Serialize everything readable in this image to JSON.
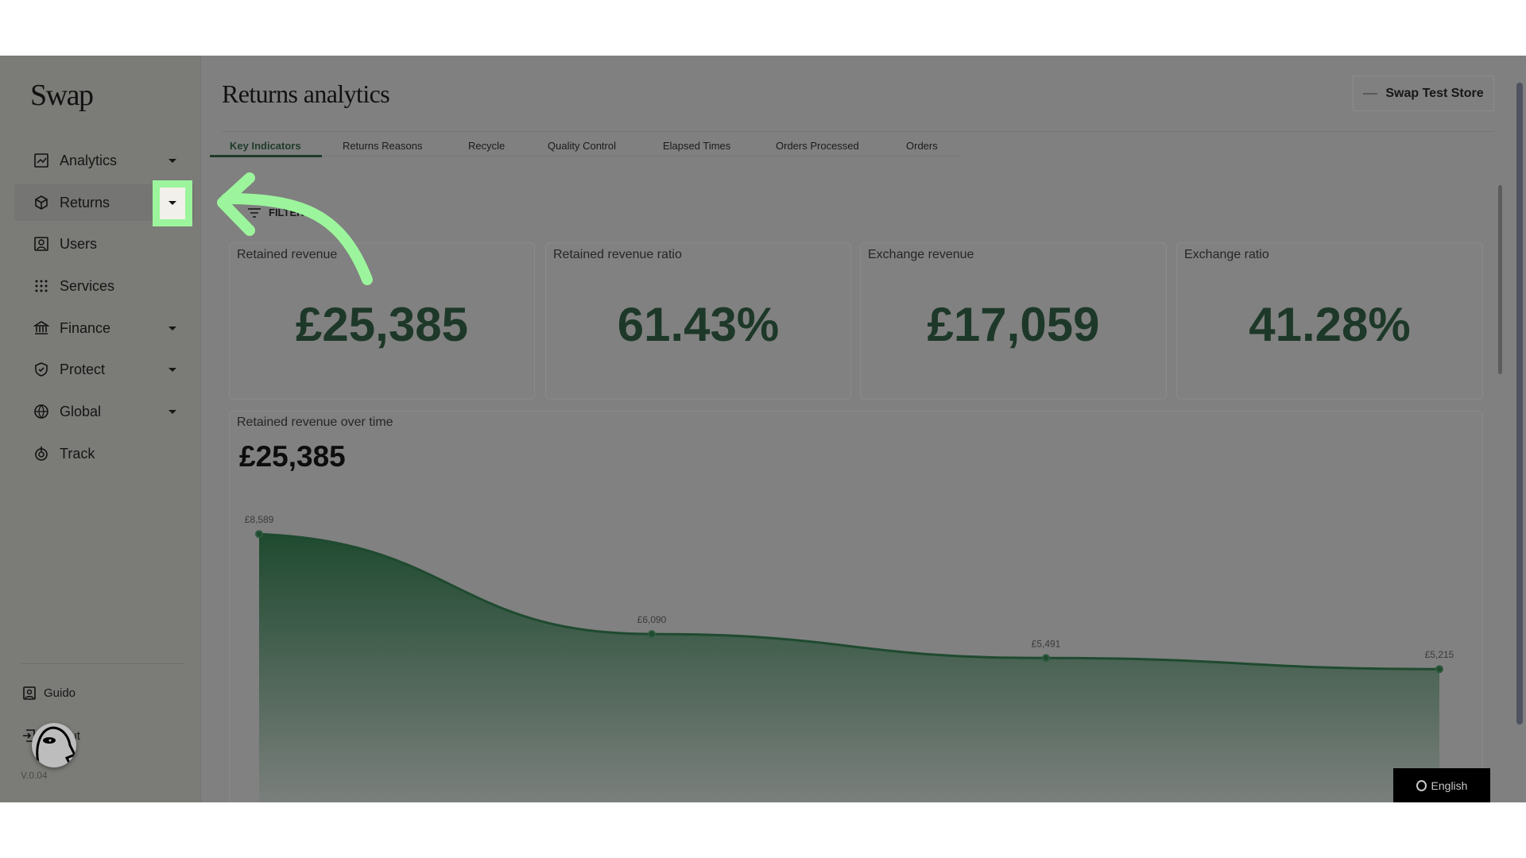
{
  "sidebar": {
    "logo": "Swap",
    "items": [
      {
        "label": "Analytics",
        "icon": "chart-icon",
        "has_dropdown": true
      },
      {
        "label": "Returns",
        "icon": "box-icon",
        "has_dropdown": true,
        "active": true
      },
      {
        "label": "Users",
        "icon": "user-icon",
        "has_dropdown": false
      },
      {
        "label": "Services",
        "icon": "grid-icon",
        "has_dropdown": false
      },
      {
        "label": "Finance",
        "icon": "bank-icon",
        "has_dropdown": true
      },
      {
        "label": "Protect",
        "icon": "shield-icon",
        "has_dropdown": true
      },
      {
        "label": "Global",
        "icon": "globe-icon",
        "has_dropdown": true
      },
      {
        "label": "Track",
        "icon": "track-icon",
        "has_dropdown": false
      }
    ],
    "user": "Guido",
    "logout": "Logout",
    "version": "V.0.04"
  },
  "header": {
    "title": "Returns analytics",
    "store": "Swap Test Store"
  },
  "tabs": [
    "Key Indicators",
    "Returns Reasons",
    "Recycle",
    "Quality Control",
    "Elapsed Times",
    "Orders Processed",
    "Orders"
  ],
  "active_tab": "Key Indicators",
  "filter_label": "FILTERS",
  "kpis": [
    {
      "label": "Retained revenue",
      "value": "£25,385"
    },
    {
      "label": "Retained revenue ratio",
      "value": "61.43%"
    },
    {
      "label": "Exchange revenue",
      "value": "£17,059"
    },
    {
      "label": "Exchange ratio",
      "value": "41.28%"
    }
  ],
  "chart_data": {
    "type": "area",
    "title": "Retained revenue over time",
    "total": "£25,385",
    "values": [
      8589,
      6090,
      5491,
      5215
    ],
    "labels": [
      "£8,589",
      "£6,090",
      "£5,491",
      "£5,215"
    ],
    "color": "#1f4a30"
  },
  "language": "English",
  "highlight_color": "#9cf59c"
}
